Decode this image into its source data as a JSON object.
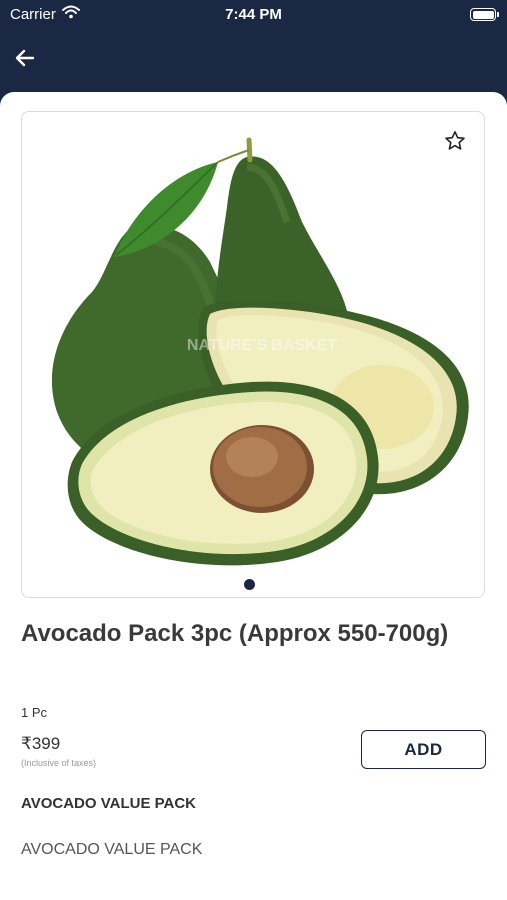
{
  "status_bar": {
    "carrier": "Carrier",
    "time": "7:44 PM"
  },
  "header": {
    "back_icon": "arrow-left-icon",
    "background_color": "#1b2844"
  },
  "product": {
    "image_alt": "Avocados",
    "watermark": "NATURE'S BASKET",
    "favorite_icon": "star-outline-icon",
    "carousel_dots": 1,
    "carousel_active_index": 0,
    "title": "Avocado Pack 3pc (Approx 550-700g)",
    "unit": "1 Pc",
    "price": "₹399",
    "tax_note": "(Inclusive of taxes)",
    "add_label": "ADD"
  },
  "description": {
    "heading": "AVOCADO VALUE PACK",
    "body": "AVOCADO VALUE PACK"
  },
  "colors": {
    "brand_navy": "#1b2844",
    "avocado_skin": "#3f6a2c",
    "avocado_flesh": "#f1efc0",
    "pit": "#9c6a44"
  }
}
